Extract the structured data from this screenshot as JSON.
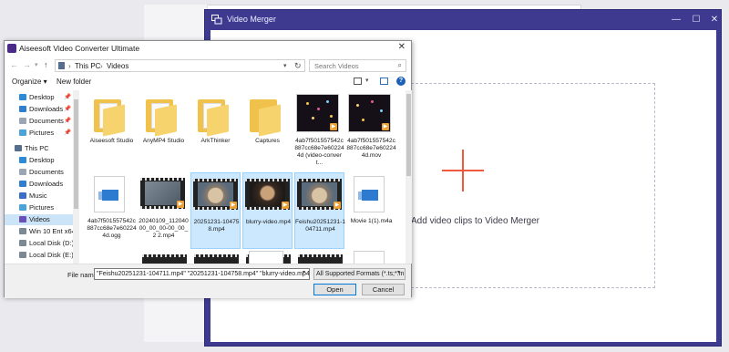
{
  "merger": {
    "title": "Video Merger",
    "minimize": "—",
    "maximize": "☐",
    "close": "✕",
    "drop_label": "Add video clips to Video Merger",
    "accent": "#3d3a8f",
    "plus_color": "#f05a3c"
  },
  "dialog": {
    "title": "Aiseesoft Video Converter Ultimate",
    "close": "✕",
    "address": {
      "root": "This PC",
      "folder": "Videos"
    },
    "search_placeholder": "Search Videos",
    "organize": "Organize ▾",
    "new_folder": "New folder",
    "help": "?",
    "nav": [
      {
        "label": "Desktop",
        "icon": "desktop-icon",
        "pinned": true
      },
      {
        "label": "Downloads",
        "icon": "downloads-icon",
        "pinned": true
      },
      {
        "label": "Documents",
        "icon": "documents-icon",
        "pinned": true
      },
      {
        "label": "Pictures",
        "icon": "pictures-icon",
        "pinned": true
      },
      {
        "label": "This PC",
        "icon": "pc-icon",
        "pinned": false
      },
      {
        "label": "Desktop",
        "icon": "desktop-icon",
        "pinned": false
      },
      {
        "label": "Documents",
        "icon": "documents-icon",
        "pinned": false
      },
      {
        "label": "Downloads",
        "icon": "downloads-icon",
        "pinned": false
      },
      {
        "label": "Music",
        "icon": "music-icon",
        "pinned": false
      },
      {
        "label": "Pictures",
        "icon": "pictures-icon",
        "pinned": false
      },
      {
        "label": "Videos",
        "icon": "videos-icon",
        "pinned": false,
        "selected": true
      },
      {
        "label": "Win 10 Ent x64 (",
        "icon": "drive-icon",
        "pinned": false
      },
      {
        "label": "Local Disk (D:)",
        "icon": "drive-icon",
        "pinned": false
      },
      {
        "label": "Local Disk (E:)",
        "icon": "drive-icon",
        "pinned": false
      }
    ],
    "files": [
      {
        "name": "Aiseesoft Studio",
        "kind": "folder"
      },
      {
        "name": "AnyMP4 Studio",
        "kind": "folder"
      },
      {
        "name": "ArkThinker",
        "kind": "folder"
      },
      {
        "name": "Captures",
        "kind": "folder"
      },
      {
        "name": "4ab7f501557542c887cc68e7e602244d (video-convert...",
        "kind": "fireworks"
      },
      {
        "name": "4ab7f501557542c887cc68e7e602244d.mov",
        "kind": "fireworks"
      },
      {
        "name": "4ab7f501557542c887cc68e7e602244d.ogg",
        "kind": "doc"
      },
      {
        "name": "20240109_112040 00_00_00-00_00_2 2.mp4",
        "kind": "film-gray"
      },
      {
        "name": "20251231-104758.mp4",
        "kind": "film-cat",
        "selected": true
      },
      {
        "name": "blurry-video.mp4",
        "kind": "film-dark",
        "selected": true
      },
      {
        "name": "Feishu20251231-104711.mp4",
        "kind": "film-cat",
        "selected": true
      },
      {
        "name": "Movie 1(1).m4a",
        "kind": "doc"
      }
    ],
    "file_name_label": "File name:",
    "file_name_value": "\"Feishu20251231-104711.mp4\" \"20251231-104758.mp4\" \"blurry-video.mp4\"",
    "filter_value": "All Supported Formats (*.ts;*.m",
    "open_label": "Open",
    "cancel_label": "Cancel"
  }
}
